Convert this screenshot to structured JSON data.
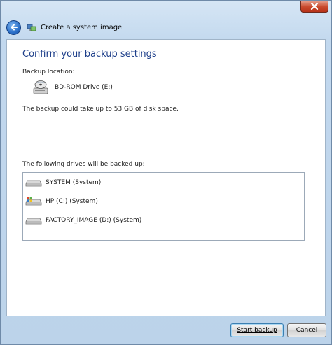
{
  "window": {
    "title": "Create a system image",
    "icons": {
      "close": "close-icon",
      "back": "back-arrow-icon",
      "app": "system-image-icon"
    }
  },
  "content": {
    "heading": "Confirm your backup settings",
    "backup_location_label": "Backup location:",
    "backup_location": {
      "name": "BD-ROM Drive (E:)",
      "icon": "optical-drive-icon"
    },
    "size_text": "The backup could take up to 53 GB of disk space.",
    "drives_label": "The following drives will be backed up:",
    "drives": [
      {
        "name": "SYSTEM (System)",
        "icon": "hard-drive-icon"
      },
      {
        "name": "HP (C:) (System)",
        "icon": "windows-drive-icon"
      },
      {
        "name": "FACTORY_IMAGE (D:) (System)",
        "icon": "hard-drive-icon"
      }
    ]
  },
  "buttons": {
    "start_backup": "Start backup",
    "cancel": "Cancel"
  },
  "colors": {
    "heading": "#1e3f8a",
    "close_button": "#c9492c",
    "back_button": "#2a6fc9"
  }
}
